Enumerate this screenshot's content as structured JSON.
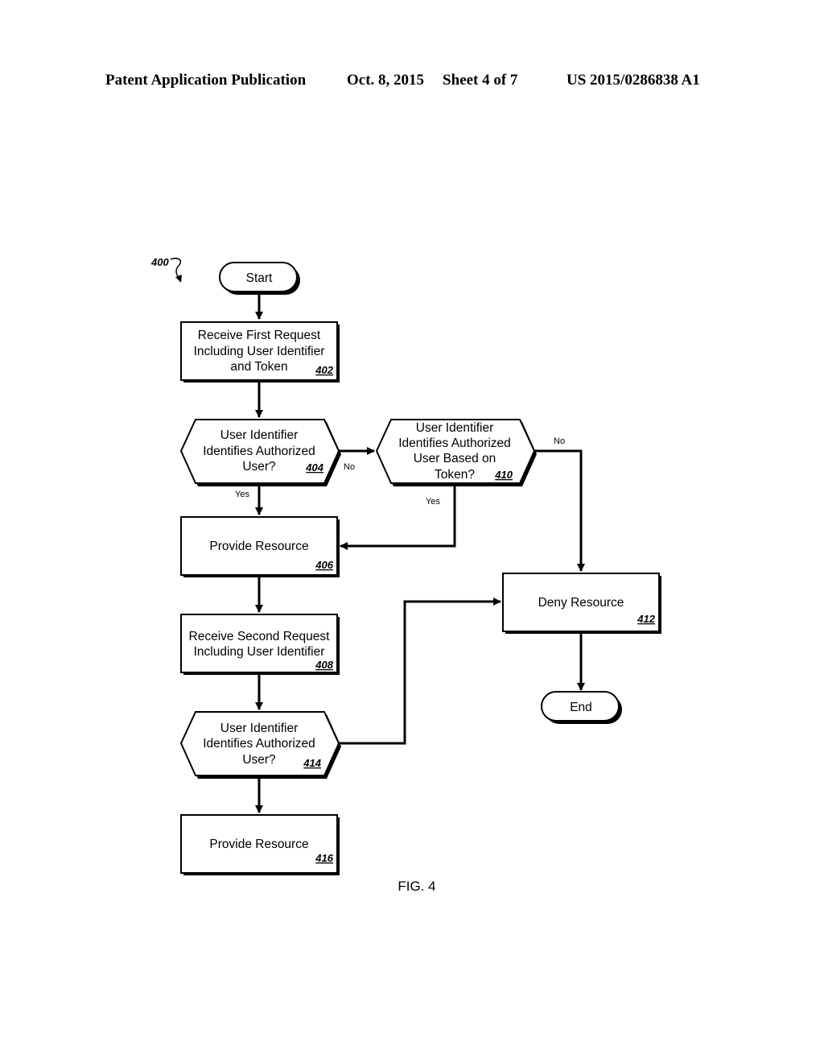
{
  "header": {
    "publication": "Patent Application Publication",
    "date": "Oct. 8, 2015",
    "sheet": "Sheet 4 of 7",
    "number": "US 2015/0286838 A1"
  },
  "diagram": {
    "ref": "400",
    "figure_label": "FIG. 4",
    "nodes": {
      "start": {
        "type": "terminator",
        "text": [
          "Start"
        ]
      },
      "n402": {
        "type": "process",
        "text": [
          "Receive First Request",
          "Including User Identifier",
          "and Token"
        ],
        "ref": "402"
      },
      "n404": {
        "type": "decision",
        "text": [
          "User Identifier",
          "Identifies Authorized",
          "User?"
        ],
        "ref": "404"
      },
      "n410": {
        "type": "decision",
        "text": [
          "User Identifier",
          "Identifies Authorized",
          "User Based on",
          "Token?"
        ],
        "ref": "410"
      },
      "n406": {
        "type": "process",
        "text": [
          "Provide Resource"
        ],
        "ref": "406"
      },
      "n412": {
        "type": "process",
        "text": [
          "Deny Resource"
        ],
        "ref": "412"
      },
      "n408": {
        "type": "process",
        "text": [
          "Receive Second Request",
          "Including User Identifier"
        ],
        "ref": "408"
      },
      "n414": {
        "type": "decision",
        "text": [
          "User Identifier",
          "Identifies Authorized",
          "User?"
        ],
        "ref": "414"
      },
      "n416": {
        "type": "process",
        "text": [
          "Provide Resource"
        ],
        "ref": "416"
      },
      "end": {
        "type": "terminator",
        "text": [
          "End"
        ]
      }
    },
    "edges": [
      {
        "from": "start",
        "to": "n402",
        "label": ""
      },
      {
        "from": "n402",
        "to": "n404",
        "label": ""
      },
      {
        "from": "n404",
        "to": "n406",
        "label": "Yes"
      },
      {
        "from": "n404",
        "to": "n410",
        "label": "No"
      },
      {
        "from": "n410",
        "to": "n406",
        "label": "Yes"
      },
      {
        "from": "n410",
        "to": "n412",
        "label": "No"
      },
      {
        "from": "n406",
        "to": "n408",
        "label": ""
      },
      {
        "from": "n408",
        "to": "n414",
        "label": ""
      },
      {
        "from": "n414",
        "to": "n416",
        "label": ""
      },
      {
        "from": "n414",
        "to": "n412",
        "label": ""
      },
      {
        "from": "n412",
        "to": "end",
        "label": ""
      }
    ]
  }
}
